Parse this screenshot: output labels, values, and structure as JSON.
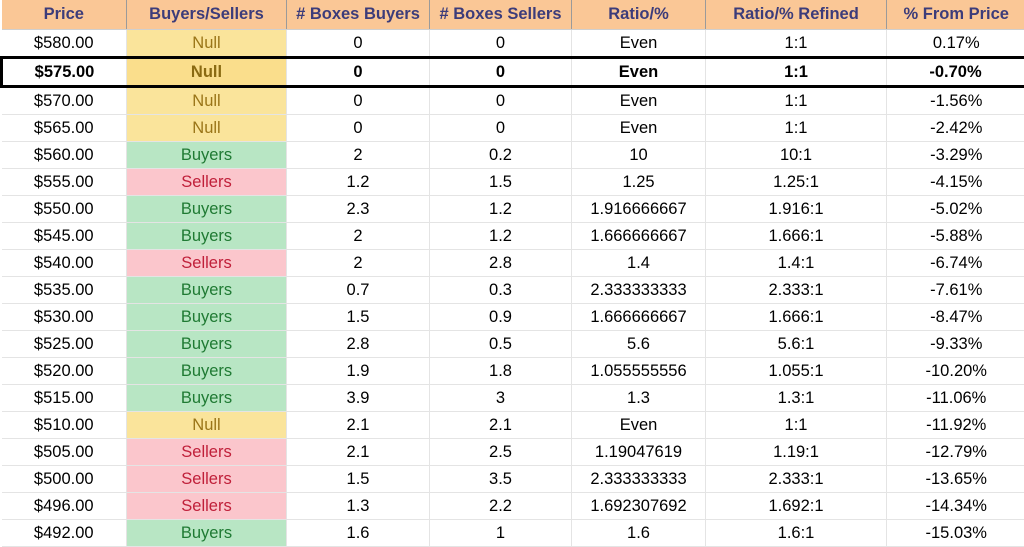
{
  "table": {
    "name": "price-levels-buyers-sellers-table",
    "columns": [
      {
        "key": "price",
        "label": "Price"
      },
      {
        "key": "signal",
        "label": "Buyers/Sellers"
      },
      {
        "key": "boxes_buyers",
        "label": "# Boxes Buyers"
      },
      {
        "key": "boxes_sellers",
        "label": "# Boxes Sellers"
      },
      {
        "key": "ratio_pct",
        "label": "Ratio/%"
      },
      {
        "key": "ratio_refined",
        "label": "Ratio/% Refined"
      },
      {
        "key": "pct_from_price",
        "label": "% From Price"
      }
    ],
    "colors": {
      "header_bg": "#fac796",
      "header_text": "#3c3c7a",
      "buyers_bg": "#b8e6c4",
      "buyers_text": "#1f7a33",
      "sellers_bg": "#fbc6cc",
      "sellers_text": "#c0203a",
      "null_bg": "#fae49b",
      "null_text": "#9a7518",
      "highlight_border": "#000000"
    },
    "rows": [
      {
        "price": "$580.00",
        "signal": "Null",
        "signal_kind": "null",
        "boxes_buyers": "0",
        "boxes_sellers": "0",
        "ratio_pct": "Even",
        "ratio_refined": "1:1",
        "pct_from_price": "0.17%",
        "highlight": false
      },
      {
        "price": "$575.00",
        "signal": "Null",
        "signal_kind": "null",
        "boxes_buyers": "0",
        "boxes_sellers": "0",
        "ratio_pct": "Even",
        "ratio_refined": "1:1",
        "pct_from_price": "-0.70%",
        "highlight": true
      },
      {
        "price": "$570.00",
        "signal": "Null",
        "signal_kind": "null",
        "boxes_buyers": "0",
        "boxes_sellers": "0",
        "ratio_pct": "Even",
        "ratio_refined": "1:1",
        "pct_from_price": "-1.56%",
        "highlight": false
      },
      {
        "price": "$565.00",
        "signal": "Null",
        "signal_kind": "null",
        "boxes_buyers": "0",
        "boxes_sellers": "0",
        "ratio_pct": "Even",
        "ratio_refined": "1:1",
        "pct_from_price": "-2.42%",
        "highlight": false
      },
      {
        "price": "$560.00",
        "signal": "Buyers",
        "signal_kind": "buyers",
        "boxes_buyers": "2",
        "boxes_sellers": "0.2",
        "ratio_pct": "10",
        "ratio_refined": "10:1",
        "pct_from_price": "-3.29%",
        "highlight": false
      },
      {
        "price": "$555.00",
        "signal": "Sellers",
        "signal_kind": "sellers",
        "boxes_buyers": "1.2",
        "boxes_sellers": "1.5",
        "ratio_pct": "1.25",
        "ratio_refined": "1.25:1",
        "pct_from_price": "-4.15%",
        "highlight": false
      },
      {
        "price": "$550.00",
        "signal": "Buyers",
        "signal_kind": "buyers",
        "boxes_buyers": "2.3",
        "boxes_sellers": "1.2",
        "ratio_pct": "1.916666667",
        "ratio_refined": "1.916:1",
        "pct_from_price": "-5.02%",
        "highlight": false
      },
      {
        "price": "$545.00",
        "signal": "Buyers",
        "signal_kind": "buyers",
        "boxes_buyers": "2",
        "boxes_sellers": "1.2",
        "ratio_pct": "1.666666667",
        "ratio_refined": "1.666:1",
        "pct_from_price": "-5.88%",
        "highlight": false
      },
      {
        "price": "$540.00",
        "signal": "Sellers",
        "signal_kind": "sellers",
        "boxes_buyers": "2",
        "boxes_sellers": "2.8",
        "ratio_pct": "1.4",
        "ratio_refined": "1.4:1",
        "pct_from_price": "-6.74%",
        "highlight": false
      },
      {
        "price": "$535.00",
        "signal": "Buyers",
        "signal_kind": "buyers",
        "boxes_buyers": "0.7",
        "boxes_sellers": "0.3",
        "ratio_pct": "2.333333333",
        "ratio_refined": "2.333:1",
        "pct_from_price": "-7.61%",
        "highlight": false
      },
      {
        "price": "$530.00",
        "signal": "Buyers",
        "signal_kind": "buyers",
        "boxes_buyers": "1.5",
        "boxes_sellers": "0.9",
        "ratio_pct": "1.666666667",
        "ratio_refined": "1.666:1",
        "pct_from_price": "-8.47%",
        "highlight": false
      },
      {
        "price": "$525.00",
        "signal": "Buyers",
        "signal_kind": "buyers",
        "boxes_buyers": "2.8",
        "boxes_sellers": "0.5",
        "ratio_pct": "5.6",
        "ratio_refined": "5.6:1",
        "pct_from_price": "-9.33%",
        "highlight": false
      },
      {
        "price": "$520.00",
        "signal": "Buyers",
        "signal_kind": "buyers",
        "boxes_buyers": "1.9",
        "boxes_sellers": "1.8",
        "ratio_pct": "1.055555556",
        "ratio_refined": "1.055:1",
        "pct_from_price": "-10.20%",
        "highlight": false
      },
      {
        "price": "$515.00",
        "signal": "Buyers",
        "signal_kind": "buyers",
        "boxes_buyers": "3.9",
        "boxes_sellers": "3",
        "ratio_pct": "1.3",
        "ratio_refined": "1.3:1",
        "pct_from_price": "-11.06%",
        "highlight": false
      },
      {
        "price": "$510.00",
        "signal": "Null",
        "signal_kind": "null",
        "boxes_buyers": "2.1",
        "boxes_sellers": "2.1",
        "ratio_pct": "Even",
        "ratio_refined": "1:1",
        "pct_from_price": "-11.92%",
        "highlight": false
      },
      {
        "price": "$505.00",
        "signal": "Sellers",
        "signal_kind": "sellers",
        "boxes_buyers": "2.1",
        "boxes_sellers": "2.5",
        "ratio_pct": "1.19047619",
        "ratio_refined": "1.19:1",
        "pct_from_price": "-12.79%",
        "highlight": false
      },
      {
        "price": "$500.00",
        "signal": "Sellers",
        "signal_kind": "sellers",
        "boxes_buyers": "1.5",
        "boxes_sellers": "3.5",
        "ratio_pct": "2.333333333",
        "ratio_refined": "2.333:1",
        "pct_from_price": "-13.65%",
        "highlight": false
      },
      {
        "price": "$496.00",
        "signal": "Sellers",
        "signal_kind": "sellers",
        "boxes_buyers": "1.3",
        "boxes_sellers": "2.2",
        "ratio_pct": "1.692307692",
        "ratio_refined": "1.692:1",
        "pct_from_price": "-14.34%",
        "highlight": false
      },
      {
        "price": "$492.00",
        "signal": "Buyers",
        "signal_kind": "buyers",
        "boxes_buyers": "1.6",
        "boxes_sellers": "1",
        "ratio_pct": "1.6",
        "ratio_refined": "1.6:1",
        "pct_from_price": "-15.03%",
        "highlight": false
      }
    ]
  }
}
